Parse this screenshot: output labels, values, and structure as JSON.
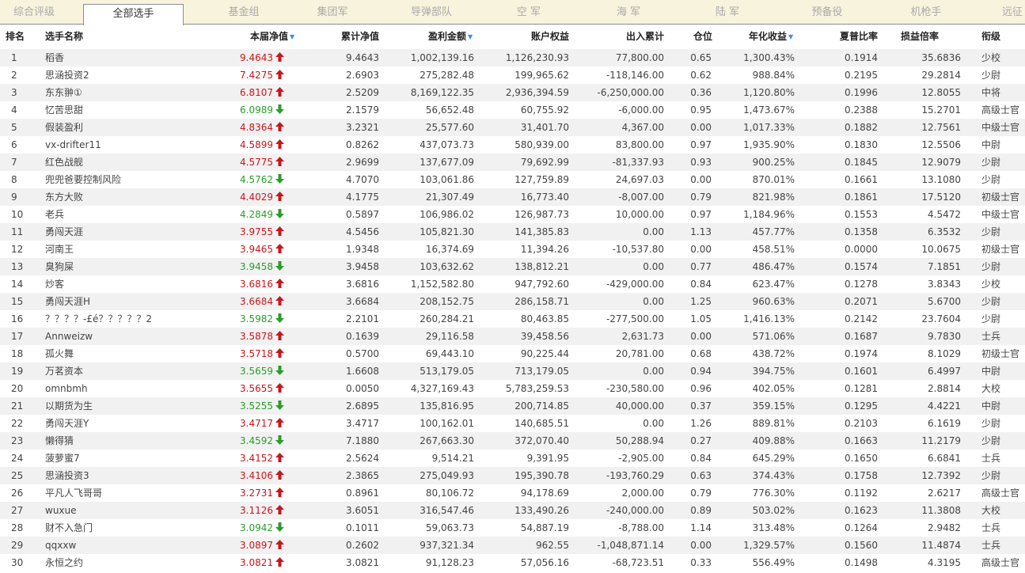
{
  "tabs": [
    {
      "label": "综合评级"
    },
    {
      "label": "全部选手"
    },
    {
      "label": "基金组"
    },
    {
      "label": "集团军"
    },
    {
      "label": "导弹部队"
    },
    {
      "label": "空  军"
    },
    {
      "label": "海  军"
    },
    {
      "label": "陆  军"
    },
    {
      "label": "预备役"
    },
    {
      "label": "机枪手"
    },
    {
      "label": "远征"
    }
  ],
  "active_tab": "全部选手",
  "columns": {
    "rank": "排名",
    "name": "选手名称",
    "nav": "本届净值",
    "cum": "累计净值",
    "pnl": "盈利金额",
    "equity": "账户权益",
    "flow": "出入累计",
    "pos": "仓位",
    "annual": "年化收益",
    "sharpe": "夏普比率",
    "ratio": "损益倍率",
    "grade": "衔级"
  },
  "sorted_columns": [
    "nav",
    "pnl",
    "annual"
  ],
  "colors": {
    "up": "#c8161d",
    "down": "#2a9d2a",
    "sort_arrow": "#3a8fd9",
    "tabbar_bg": "#f8f3dc"
  },
  "rows": [
    {
      "rank": "1",
      "name": "稻香",
      "nav": "9.4643",
      "trend": "up",
      "cum": "9.4643",
      "pnl": "1,002,139.16",
      "equity": "1,126,230.93",
      "flow": "77,800.00",
      "pos": "0.65",
      "annual": "1,300.43%",
      "sharpe": "0.1914",
      "ratio": "35.6836",
      "grade": "少校"
    },
    {
      "rank": "2",
      "name": "思涵投资2",
      "nav": "7.4275",
      "trend": "up",
      "cum": "2.6903",
      "pnl": "275,282.48",
      "equity": "199,965.62",
      "flow": "-118,146.00",
      "pos": "0.62",
      "annual": "988.84%",
      "sharpe": "0.2195",
      "ratio": "29.2814",
      "grade": "少尉"
    },
    {
      "rank": "3",
      "name": "东东翀①",
      "nav": "6.8107",
      "trend": "up",
      "cum": "2.5209",
      "pnl": "8,169,122.35",
      "equity": "2,936,394.59",
      "flow": "-6,250,000.00",
      "pos": "0.36",
      "annual": "1,120.80%",
      "sharpe": "0.1996",
      "ratio": "12.8055",
      "grade": "中将"
    },
    {
      "rank": "4",
      "name": "忆苦思甜",
      "nav": "6.0989",
      "trend": "down",
      "cum": "2.1579",
      "pnl": "56,652.48",
      "equity": "60,755.92",
      "flow": "-6,000.00",
      "pos": "0.95",
      "annual": "1,473.67%",
      "sharpe": "0.2388",
      "ratio": "15.2701",
      "grade": "高级士官"
    },
    {
      "rank": "5",
      "name": "假装盈利",
      "nav": "4.8364",
      "trend": "up",
      "cum": "3.2321",
      "pnl": "25,577.60",
      "equity": "31,401.70",
      "flow": "4,367.00",
      "pos": "0.00",
      "annual": "1,017.33%",
      "sharpe": "0.1882",
      "ratio": "12.7561",
      "grade": "中级士官"
    },
    {
      "rank": "6",
      "name": "vx-drifter11",
      "nav": "4.5899",
      "trend": "up",
      "cum": "0.8262",
      "pnl": "437,073.73",
      "equity": "580,939.00",
      "flow": "83,800.00",
      "pos": "0.97",
      "annual": "1,935.90%",
      "sharpe": "0.1830",
      "ratio": "12.5506",
      "grade": "中尉"
    },
    {
      "rank": "7",
      "name": "红色战舰",
      "nav": "4.5775",
      "trend": "up",
      "cum": "2.9699",
      "pnl": "137,677.09",
      "equity": "79,692.99",
      "flow": "-81,337.93",
      "pos": "0.93",
      "annual": "900.25%",
      "sharpe": "0.1845",
      "ratio": "12.9079",
      "grade": "少尉"
    },
    {
      "rank": "8",
      "name": "兜兜爸要控制风险",
      "nav": "4.5762",
      "trend": "down",
      "cum": "4.7070",
      "pnl": "103,061.86",
      "equity": "127,759.89",
      "flow": "24,697.03",
      "pos": "0.00",
      "annual": "870.01%",
      "sharpe": "0.1661",
      "ratio": "13.1080",
      "grade": "少尉"
    },
    {
      "rank": "9",
      "name": "东方大败",
      "nav": "4.4029",
      "trend": "up",
      "cum": "4.1775",
      "pnl": "21,307.49",
      "equity": "16,773.40",
      "flow": "-8,007.00",
      "pos": "0.79",
      "annual": "821.98%",
      "sharpe": "0.1861",
      "ratio": "17.5120",
      "grade": "初级士官"
    },
    {
      "rank": "10",
      "name": "老兵",
      "nav": "4.2849",
      "trend": "down",
      "cum": "0.5897",
      "pnl": "106,986.02",
      "equity": "126,987.73",
      "flow": "10,000.00",
      "pos": "0.97",
      "annual": "1,184.96%",
      "sharpe": "0.1553",
      "ratio": "4.5472",
      "grade": "中级士官"
    },
    {
      "rank": "11",
      "name": "勇闯天涯",
      "nav": "3.9755",
      "trend": "up",
      "cum": "4.5456",
      "pnl": "105,821.30",
      "equity": "141,385.83",
      "flow": "0.00",
      "pos": "1.13",
      "annual": "457.77%",
      "sharpe": "0.1358",
      "ratio": "6.3532",
      "grade": "少尉"
    },
    {
      "rank": "12",
      "name": "河南王",
      "nav": "3.9465",
      "trend": "up",
      "cum": "1.9348",
      "pnl": "16,374.69",
      "equity": "11,394.26",
      "flow": "-10,537.80",
      "pos": "0.00",
      "annual": "458.51%",
      "sharpe": "0.0000",
      "ratio": "10.0675",
      "grade": "初级士官"
    },
    {
      "rank": "13",
      "name": "臭狗屎",
      "nav": "3.9458",
      "trend": "down",
      "cum": "3.9458",
      "pnl": "103,632.62",
      "equity": "138,812.21",
      "flow": "0.00",
      "pos": "0.77",
      "annual": "486.47%",
      "sharpe": "0.1574",
      "ratio": "7.1851",
      "grade": "少尉"
    },
    {
      "rank": "14",
      "name": "炒客",
      "nav": "3.6816",
      "trend": "up",
      "cum": "3.6816",
      "pnl": "1,152,582.80",
      "equity": "947,792.60",
      "flow": "-429,000.00",
      "pos": "0.84",
      "annual": "623.47%",
      "sharpe": "0.1278",
      "ratio": "3.8343",
      "grade": "少校"
    },
    {
      "rank": "15",
      "name": "勇闯天涯H",
      "nav": "3.6684",
      "trend": "up",
      "cum": "3.6684",
      "pnl": "208,152.75",
      "equity": "286,158.71",
      "flow": "0.00",
      "pos": "1.25",
      "annual": "960.63%",
      "sharpe": "0.2071",
      "ratio": "5.6700",
      "grade": "少尉"
    },
    {
      "rank": "16",
      "name": "？？？？-£é？？？？？2",
      "nav": "3.5982",
      "trend": "down",
      "cum": "2.2101",
      "pnl": "260,284.21",
      "equity": "80,463.85",
      "flow": "-277,500.00",
      "pos": "1.05",
      "annual": "1,416.13%",
      "sharpe": "0.2142",
      "ratio": "23.7604",
      "grade": "少尉"
    },
    {
      "rank": "17",
      "name": "Annweizw",
      "nav": "3.5878",
      "trend": "up",
      "cum": "0.1639",
      "pnl": "29,116.58",
      "equity": "39,458.56",
      "flow": "2,631.73",
      "pos": "0.00",
      "annual": "571.06%",
      "sharpe": "0.1687",
      "ratio": "9.7830",
      "grade": "士兵"
    },
    {
      "rank": "18",
      "name": "孤火舞",
      "nav": "3.5718",
      "trend": "up",
      "cum": "0.5700",
      "pnl": "69,443.10",
      "equity": "90,225.44",
      "flow": "20,781.00",
      "pos": "0.68",
      "annual": "438.72%",
      "sharpe": "0.1974",
      "ratio": "8.1029",
      "grade": "初级士官"
    },
    {
      "rank": "19",
      "name": "万茗资本",
      "nav": "3.5659",
      "trend": "down",
      "cum": "1.6608",
      "pnl": "513,179.05",
      "equity": "713,179.05",
      "flow": "0.00",
      "pos": "0.94",
      "annual": "394.75%",
      "sharpe": "0.1601",
      "ratio": "6.4997",
      "grade": "中尉"
    },
    {
      "rank": "20",
      "name": "omnbmh",
      "nav": "3.5655",
      "trend": "up",
      "cum": "0.0050",
      "pnl": "4,327,169.43",
      "equity": "5,783,259.53",
      "flow": "-230,580.00",
      "pos": "0.96",
      "annual": "402.05%",
      "sharpe": "0.1281",
      "ratio": "2.8814",
      "grade": "大校"
    },
    {
      "rank": "21",
      "name": "以期货为生",
      "nav": "3.5255",
      "trend": "down",
      "cum": "2.6895",
      "pnl": "135,816.95",
      "equity": "200,714.85",
      "flow": "40,000.00",
      "pos": "0.37",
      "annual": "359.15%",
      "sharpe": "0.1295",
      "ratio": "4.4221",
      "grade": "中尉"
    },
    {
      "rank": "22",
      "name": "勇闯天涯Y",
      "nav": "3.4717",
      "trend": "up",
      "cum": "3.4717",
      "pnl": "100,162.01",
      "equity": "140,685.51",
      "flow": "0.00",
      "pos": "1.26",
      "annual": "889.81%",
      "sharpe": "0.2103",
      "ratio": "6.1619",
      "grade": "少尉"
    },
    {
      "rank": "23",
      "name": "懒得猜",
      "nav": "3.4592",
      "trend": "down",
      "cum": "7.1880",
      "pnl": "267,663.30",
      "equity": "372,070.40",
      "flow": "50,288.94",
      "pos": "0.27",
      "annual": "409.88%",
      "sharpe": "0.1663",
      "ratio": "11.2179",
      "grade": "少尉"
    },
    {
      "rank": "24",
      "name": "菠萝蜜7",
      "nav": "3.4152",
      "trend": "up",
      "cum": "2.5624",
      "pnl": "9,514.21",
      "equity": "9,391.95",
      "flow": "-2,905.00",
      "pos": "0.84",
      "annual": "645.29%",
      "sharpe": "0.1650",
      "ratio": "6.6841",
      "grade": "士兵"
    },
    {
      "rank": "25",
      "name": "思涵投资3",
      "nav": "3.4106",
      "trend": "up",
      "cum": "2.3865",
      "pnl": "275,049.93",
      "equity": "195,390.78",
      "flow": "-193,760.29",
      "pos": "0.63",
      "annual": "374.43%",
      "sharpe": "0.1758",
      "ratio": "12.7392",
      "grade": "少尉"
    },
    {
      "rank": "26",
      "name": "平凡人飞哥哥",
      "nav": "3.2731",
      "trend": "up",
      "cum": "0.8961",
      "pnl": "80,106.72",
      "equity": "94,178.69",
      "flow": "2,000.00",
      "pos": "0.79",
      "annual": "776.30%",
      "sharpe": "0.1192",
      "ratio": "2.6217",
      "grade": "高级士官"
    },
    {
      "rank": "27",
      "name": "wuxue",
      "nav": "3.1126",
      "trend": "up",
      "cum": "3.6051",
      "pnl": "316,547.46",
      "equity": "133,490.26",
      "flow": "-240,000.00",
      "pos": "0.89",
      "annual": "503.02%",
      "sharpe": "0.1623",
      "ratio": "11.3808",
      "grade": "大校"
    },
    {
      "rank": "28",
      "name": "财不入急门",
      "nav": "3.0942",
      "trend": "down",
      "cum": "0.1011",
      "pnl": "59,063.73",
      "equity": "54,887.19",
      "flow": "-8,788.00",
      "pos": "1.14",
      "annual": "313.48%",
      "sharpe": "0.1264",
      "ratio": "2.9482",
      "grade": "士兵"
    },
    {
      "rank": "29",
      "name": "qqxxw",
      "nav": "3.0897",
      "trend": "up",
      "cum": "0.2602",
      "pnl": "937,321.34",
      "equity": "962.55",
      "flow": "-1,048,871.14",
      "pos": "0.00",
      "annual": "1,329.57%",
      "sharpe": "0.1560",
      "ratio": "11.4874",
      "grade": "士兵"
    },
    {
      "rank": "30",
      "name": "永恒之约",
      "nav": "3.0821",
      "trend": "up",
      "cum": "3.0821",
      "pnl": "91,128.23",
      "equity": "57,056.16",
      "flow": "-68,723.51",
      "pos": "0.33",
      "annual": "556.49%",
      "sharpe": "0.1498",
      "ratio": "4.3195",
      "grade": "高级士官"
    }
  ]
}
